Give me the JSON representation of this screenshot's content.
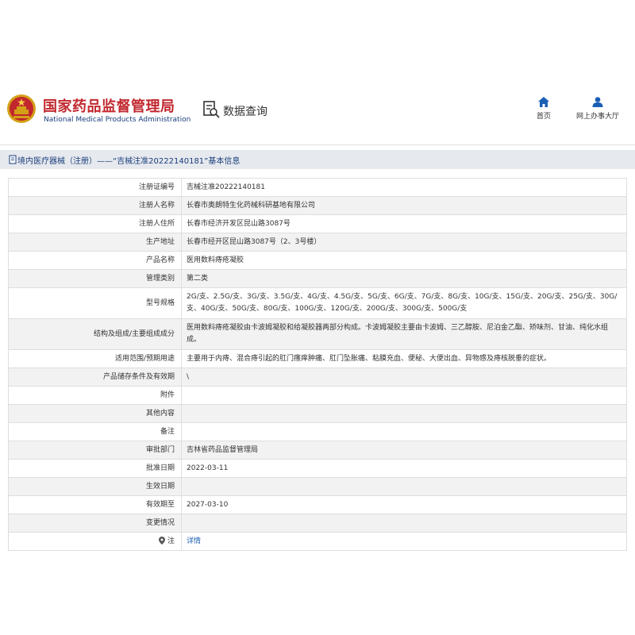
{
  "header": {
    "site_title": "国家药品监督管理局",
    "site_subtitle": "National Medical Products Administration",
    "data_query_label": "数据查询",
    "nav": {
      "home_label": "首页",
      "online_label": "网上办事大厅"
    },
    "colors": {
      "brand_red": "#c1272d",
      "brand_blue": "#1a3d7c"
    },
    "icons": [
      "national-emblem-icon",
      "data-query-icon",
      "home-icon",
      "user-icon"
    ]
  },
  "breadcrumb": {
    "text": "境内医疗器械（注册）——“吉械注准20222140181”基本信息",
    "icon": "document-icon"
  },
  "rows": [
    {
      "label": "注册证编号",
      "value": "吉械注准20222140181"
    },
    {
      "label": "注册人名称",
      "value": "长春市奥朗特生化药械科研基地有限公司"
    },
    {
      "label": "注册人住所",
      "value": "长春市经济开发区昆山路3087号"
    },
    {
      "label": "生产地址",
      "value": "长春市经开区昆山路3087号（2、3号楼）"
    },
    {
      "label": "产品名称",
      "value": "医用数料痔疮凝胶"
    },
    {
      "label": "管理类别",
      "value": "第二类"
    },
    {
      "label": "型号规格",
      "value": "2G/支、2.5G/支、3G/支、3.5G/支、4G/支、4.5G/支、5G/支、6G/支、7G/支、8G/支、10G/支、15G/支、20G/支、25G/支、30G/支、40G/支、50G/支、80G/支、100G/支、120G/支、200G/支、300G/支、500G/支"
    },
    {
      "label": "结构及组成/主要组成成分",
      "value": "医用数料痔疮凝胶由卡波姆凝胶和给凝胶器两部分构成。卡波姆凝胶主要由卡波姆、三乙醇胺、尼泊金乙酯、矫味剂、甘油、纯化水组成。"
    },
    {
      "label": "适用范围/预期用途",
      "value": "主要用于内痔、混合痔引起的肛门瘙痒肿痛、肛门坠胀痛、粘膜充血、便秘、大便出血、异物感及痔核脱垂的症状。"
    },
    {
      "label": "产品储存条件及有效期",
      "value": "\\"
    },
    {
      "label": "附件",
      "value": ""
    },
    {
      "label": "其他内容",
      "value": ""
    },
    {
      "label": "备注",
      "value": ""
    },
    {
      "label": "审批部门",
      "value": "吉林省药品监督管理局"
    },
    {
      "label": "批准日期",
      "value": "2022-03-11"
    },
    {
      "label": "生效日期",
      "value": ""
    },
    {
      "label": "有效期至",
      "value": "2027-03-10"
    },
    {
      "label": "变更情况",
      "value": ""
    },
    {
      "label": "注",
      "value": "详情"
    }
  ]
}
